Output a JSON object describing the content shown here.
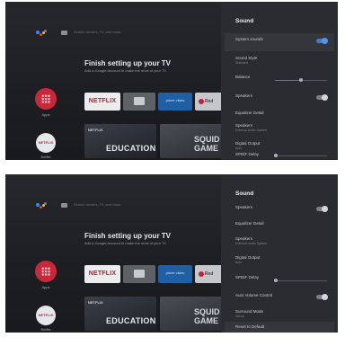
{
  "shared": {
    "search_placeholder": "Search movies, TV, and more",
    "setup_title": "Finish setting up your TV",
    "setup_subtitle": "Add a Google Account to make the most of your TV",
    "apps_label": "Apps",
    "netflix_label": "Netflix",
    "netflix_icon_text": "NETFLIX",
    "netflix_tile_text": "NETFLIX",
    "prime_tile_text": "prime video",
    "red_tile_text": "Red",
    "content1_tag": "NETFLIX",
    "content1_title": "EDUCATION",
    "content2_title": "SQUID GAME"
  },
  "screen1": {
    "panel_title": "Sound",
    "rows": [
      {
        "label": "System sounds",
        "control": "toggle",
        "on": true
      },
      {
        "label": "Sound Style",
        "sub": "Standard"
      },
      {
        "label": "Balance",
        "control": "slider",
        "value": 0.5
      },
      {
        "label": "Speakers",
        "control": "toggle",
        "on": false
      },
      {
        "label": "Equalizer Detail"
      },
      {
        "label": "Speakers",
        "sub": "External Audio System"
      },
      {
        "label": "Digital Output",
        "sub": "Auto"
      },
      {
        "label": "SPDIF Delay",
        "control": "slider",
        "value": 0.0
      }
    ]
  },
  "screen2": {
    "panel_title": "Sound",
    "rows": [
      {
        "label": "Speakers",
        "control": "toggle",
        "on": false
      },
      {
        "label": "Equalizer Detail"
      },
      {
        "label": "Speakers",
        "sub": "External Audio System"
      },
      {
        "label": "Digital Output",
        "sub": "Auto"
      },
      {
        "label": "SPDIF Delay",
        "control": "slider",
        "value": 0.0
      },
      {
        "label": "Auto Volume Control",
        "control": "toggle",
        "on": false
      },
      {
        "label": "Surround Mode",
        "sub": "Stereo"
      },
      {
        "label": "Reset to Default"
      }
    ]
  }
}
